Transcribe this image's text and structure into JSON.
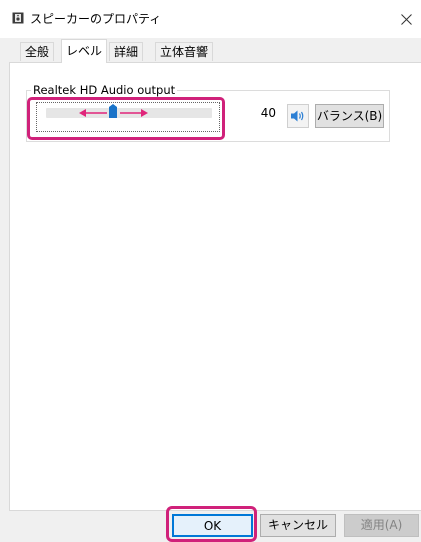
{
  "window": {
    "title": "スピーカーのプロパティ",
    "icon": "speaker-icon",
    "close_icon": "close-icon"
  },
  "tabs": [
    {
      "label": "全般",
      "active": false
    },
    {
      "label": "レベル",
      "active": true
    },
    {
      "label": "詳細",
      "active": false
    },
    {
      "label": "立体音響",
      "active": false
    }
  ],
  "level": {
    "device_label": "Realtek HD Audio output",
    "volume_value": "40",
    "volume_level": 0.4,
    "mute_icon": "speaker-volume-icon",
    "balance_button": "バランス(B)"
  },
  "footer": {
    "ok": "OK",
    "cancel": "キャンセル",
    "apply": "適用(A)"
  },
  "colors": {
    "highlight": "#d0217a",
    "arrow": "#e0257a",
    "thumb": "#1a73c8",
    "ok_border": "#0078d7"
  }
}
